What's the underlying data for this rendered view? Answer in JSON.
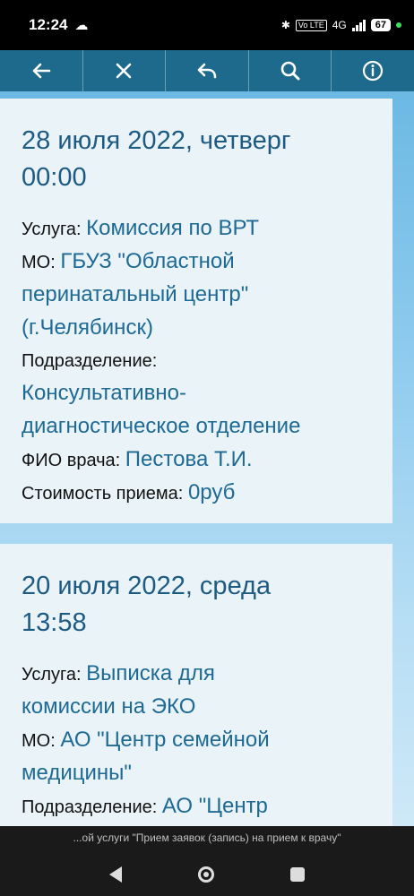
{
  "status_bar": {
    "time": "12:24",
    "battery": "67",
    "network": "4G",
    "volte": "Vo LTE"
  },
  "toolbar": {
    "buttons": [
      {
        "name": "back",
        "icon": "arrow-left-icon"
      },
      {
        "name": "close",
        "icon": "close-icon"
      },
      {
        "name": "undo",
        "icon": "undo-arrow-icon"
      },
      {
        "name": "search",
        "icon": "search-icon"
      },
      {
        "name": "info",
        "icon": "info-icon"
      }
    ]
  },
  "appointments": [
    {
      "date": "28 июля 2022, четверг",
      "time": "00:00",
      "service_label": "Услуга:",
      "service": "Комиссия по ВРТ",
      "mo_label": "МО:",
      "mo_line1": "ГБУЗ \"Областной",
      "mo_line2": "перинатальный центр\"",
      "mo_line3": "(г.Челябинск)",
      "department_label": "Подразделение:",
      "department_line1": "Консультативно-",
      "department_line2": "диагностическое отделение",
      "doctor_label": "ФИО врача:",
      "doctor": "Пестова Т.И.",
      "cost_label": "Стоимость приема:",
      "cost": "0руб"
    },
    {
      "date": "20 июля 2022, среда",
      "time": "13:58",
      "service_label": "Услуга:",
      "service_line1": "Выписка для",
      "service_line2": "комиссии на ЭКО",
      "mo_label": "МО:",
      "mo_line1": "АО \"Центр семейной",
      "mo_line2": "медицины\"",
      "department_label": "Подразделение:",
      "department_line1": "АО \"Центр"
    }
  ],
  "bottom_notice": "...ой услуги \"Прием заявок (запись) на прием к врачу\"",
  "colors": {
    "toolbar": "#1e6a8d",
    "accent_text": "#1e6a94",
    "card": "#e9f3f8"
  }
}
